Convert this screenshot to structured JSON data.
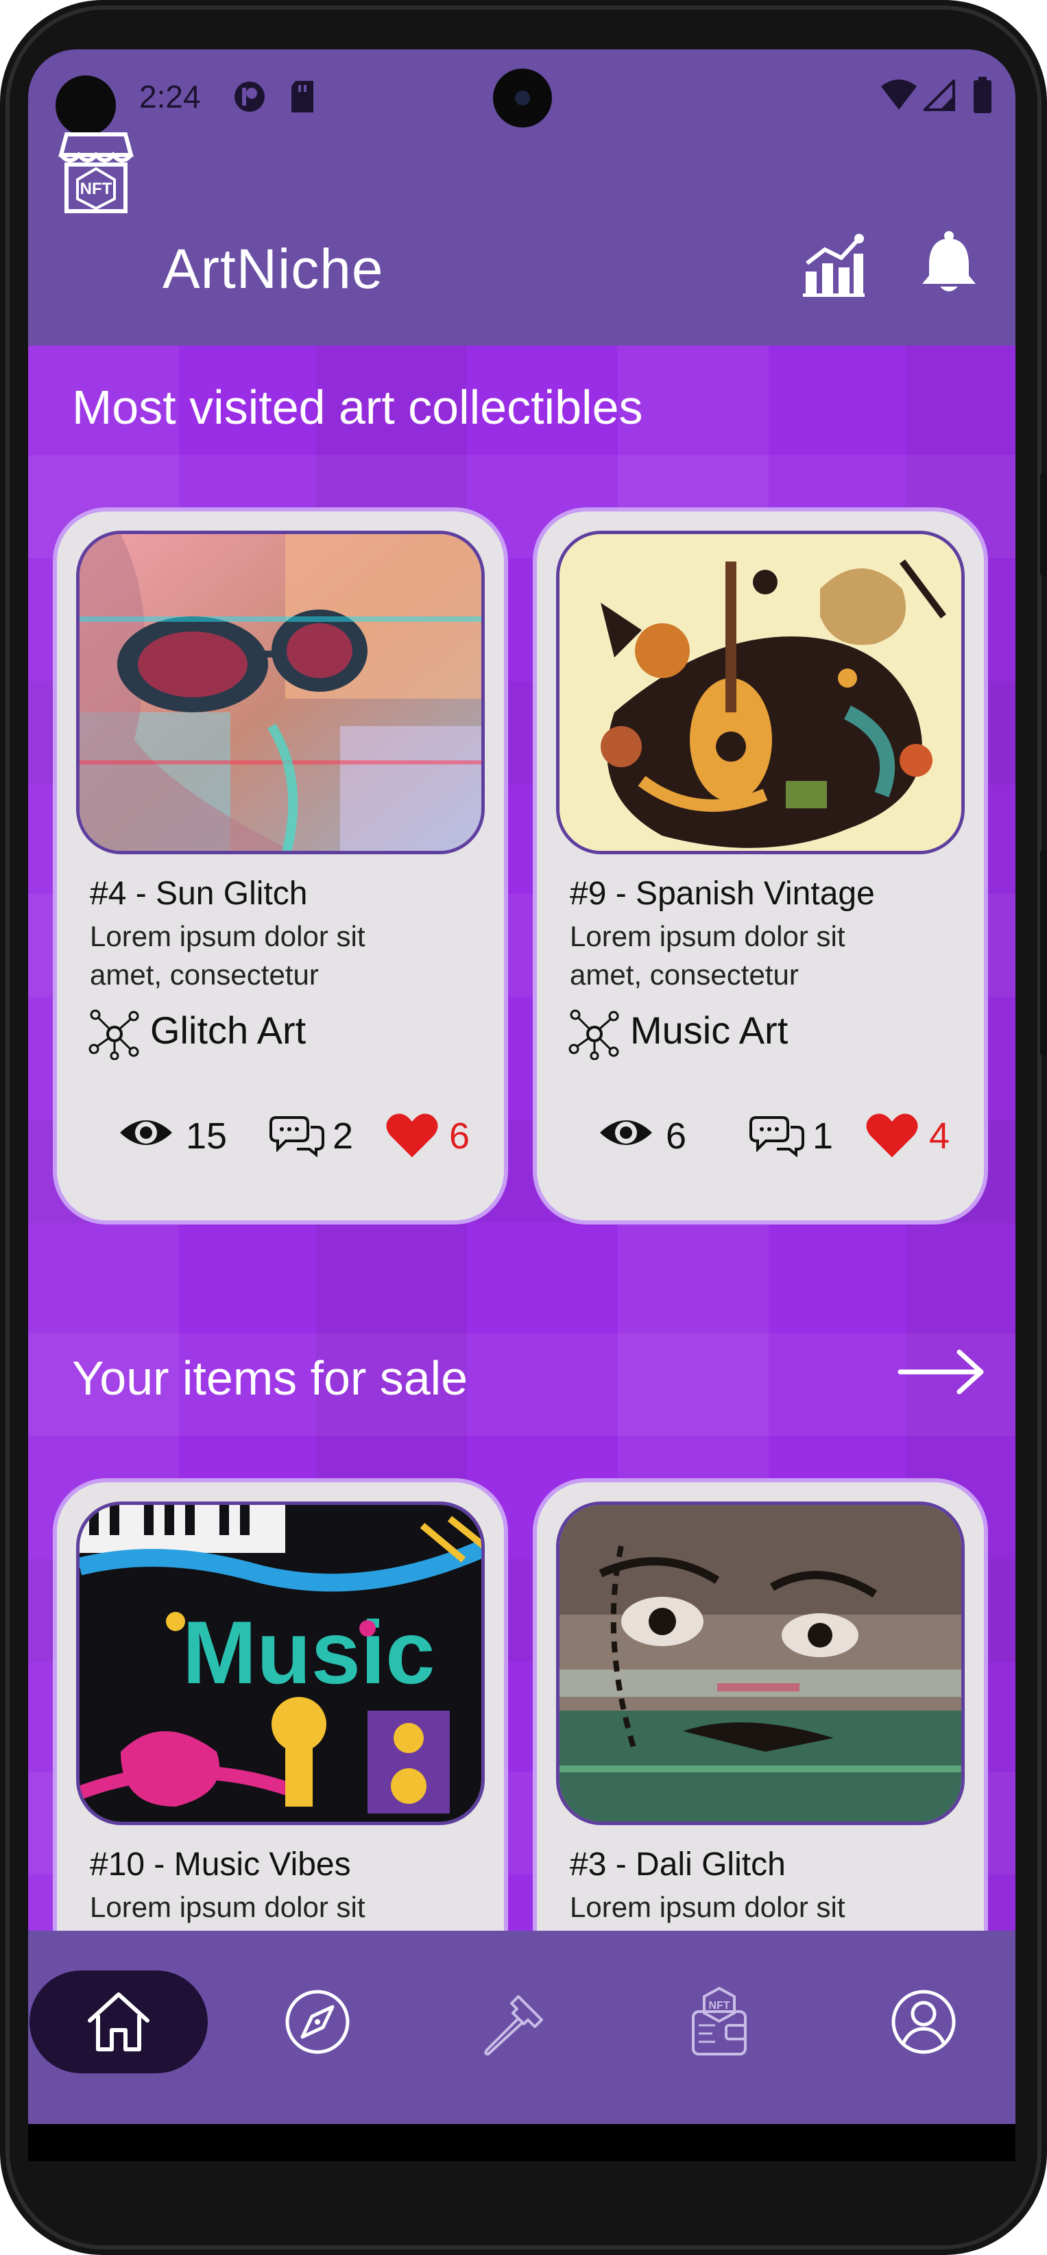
{
  "status_bar": {
    "time": "2:24"
  },
  "app_bar": {
    "title": "ArtNiche",
    "logo_icon": "nft-shop-logo-icon",
    "actions": [
      "chart-icon",
      "bell-icon"
    ]
  },
  "sections": {
    "most_visited_title": "Most visited art collectibles",
    "for_sale_title": "Your items for sale"
  },
  "most_visited": [
    {
      "title": "#4 - Sun Glitch",
      "desc_line1": "Lorem ipsum dolor sit",
      "desc_line2": "amet, consectetur",
      "category": "Glitch Art",
      "views": "15",
      "comments": "2",
      "likes": "6"
    },
    {
      "title": "#9 - Spanish Vintage",
      "desc_line1": "Lorem ipsum dolor sit",
      "desc_line2": "amet, consectetur",
      "category": "Music Art",
      "views": "6",
      "comments": "1",
      "likes": "4"
    }
  ],
  "for_sale": [
    {
      "title": "#10 - Music Vibes",
      "desc_line1": "Lorem ipsum dolor sit"
    },
    {
      "title": "#3 - Dali Glitch",
      "desc_line1": "Lorem ipsum dolor sit"
    }
  ],
  "bottom_nav": {
    "items": [
      "home-icon",
      "compass-icon",
      "hammer-icon",
      "nft-wallet-icon",
      "profile-icon"
    ],
    "active": "home-icon"
  },
  "colors": {
    "primary": "#6a4fa5",
    "background": "#9a2ee6",
    "card": "#e6e3e6",
    "card_border": "#c89df5",
    "like": "#e11d1d",
    "nav_active": "#1f1035"
  }
}
